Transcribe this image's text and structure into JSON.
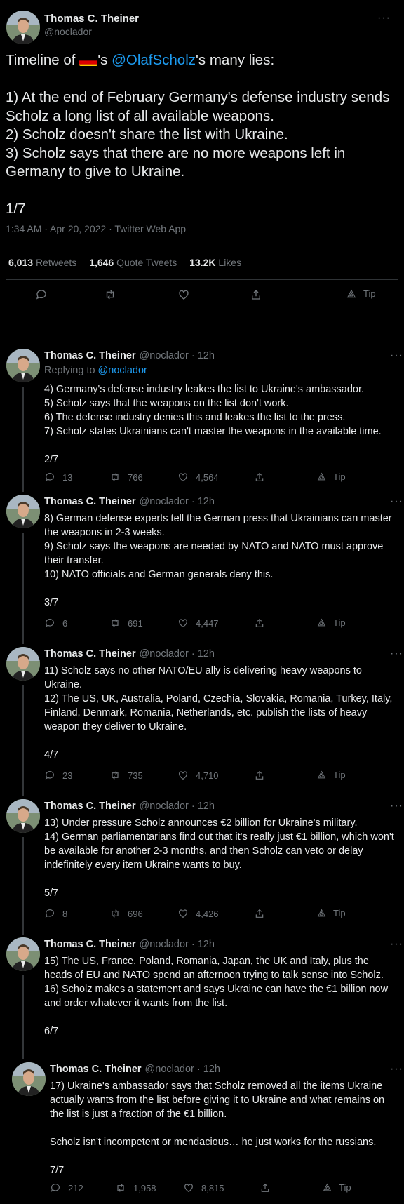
{
  "main": {
    "name": "Thomas C. Theiner",
    "handle": "@noclador",
    "more": "···",
    "text_pre": "Timeline of ",
    "text_mid": "'s ",
    "mention": "@OlafScholz",
    "text_post": "'s many lies:",
    "lines": [
      "1) At the end of February Germany's defense industry sends Scholz a long list of all available weapons.",
      "2) Scholz doesn't share the list with Ukraine.",
      "3) Scholz says that there are no more weapons left in Germany to give to Ukraine."
    ],
    "counter": "1/7",
    "meta": "1:34 AM · Apr 20, 2022 · Twitter Web App",
    "retweets_num": "6,013",
    "retweets_label": "Retweets",
    "quotes_num": "1,646",
    "quotes_label": "Quote Tweets",
    "likes_num": "13.2K",
    "likes_label": "Likes",
    "tip": "Tip",
    "flag_colors": [
      "#000000",
      "#dd0000",
      "#ffce00"
    ]
  },
  "replying_label": "Replying to",
  "replying_handle": "@noclador",
  "replies": [
    {
      "name": "Thomas C. Theiner",
      "handle": "@noclador",
      "time": "· 12h",
      "lines": [
        "4) Germany's defense industry leakes the list to Ukraine's ambassador.",
        "5) Scholz says that the weapons on the list don't work.",
        "6) The defense industry denies this and leakes the list to the press.",
        "7) Scholz states Ukrainians can't master the weapons in the available time."
      ],
      "counter": "2/7",
      "replies": "13",
      "retweets": "766",
      "likes": "4,564",
      "tip": "Tip"
    },
    {
      "name": "Thomas C. Theiner",
      "handle": "@noclador",
      "time": "· 12h",
      "lines": [
        "8) German defense experts tell the German press that Ukrainians can master the weapons in 2-3 weeks.",
        "9) Scholz says the weapons are needed by NATO and NATO must approve their transfer.",
        "10) NATO officials and German generals deny this."
      ],
      "counter": "3/7",
      "replies": "6",
      "retweets": "691",
      "likes": "4,447",
      "tip": "Tip"
    },
    {
      "name": "Thomas C. Theiner",
      "handle": "@noclador",
      "time": "· 12h",
      "lines": [
        "11) Scholz says no other NATO/EU ally is delivering heavy weapons to Ukraine.",
        "12) The US, UK, Australia, Poland, Czechia, Slovakia, Romania, Turkey, Italy, Finland, Denmark, Romania, Netherlands, etc. publish the lists of heavy weapon they deliver to Ukraine."
      ],
      "counter": "4/7",
      "replies": "23",
      "retweets": "735",
      "likes": "4,710",
      "tip": "Tip"
    },
    {
      "name": "Thomas C. Theiner",
      "handle": "@noclador",
      "time": "· 12h",
      "lines": [
        "13) Under pressure Scholz announces €2 billion for Ukraine's military.",
        "14) German parliamentarians find out that it's really just €1 billion, which won't be available for another 2-3 months, and then Scholz can veto or delay indefinitely every item Ukraine wants to buy."
      ],
      "counter": "5/7",
      "replies": "8",
      "retweets": "696",
      "likes": "4,426",
      "tip": "Tip"
    },
    {
      "name": "Thomas C. Theiner",
      "handle": "@noclador",
      "time": "· 12h",
      "lines": [
        "15) The US, France, Poland, Romania, Japan, the UK and Italy, plus the heads of EU and NATO spend an afternoon trying to talk sense into Scholz.",
        "16) Scholz makes a statement and says Ukraine can have the €1 billion now and order whatever it wants from the list."
      ],
      "counter": "6/7"
    },
    {
      "name": "Thomas C. Theiner",
      "handle": "@noclador",
      "time": "· 12h",
      "lines": [
        "17) Ukraine's ambassador says that Scholz removed all the items Ukraine actually wants from the list before giving it to Ukraine and what remains on the list is just a fraction of the €1 billion.",
        "",
        "Scholz isn't incompetent or mendacious… he just works for the russians."
      ],
      "counter": "7/7",
      "replies": "212",
      "retweets": "1,958",
      "likes": "8,815",
      "tip": "Tip"
    }
  ]
}
